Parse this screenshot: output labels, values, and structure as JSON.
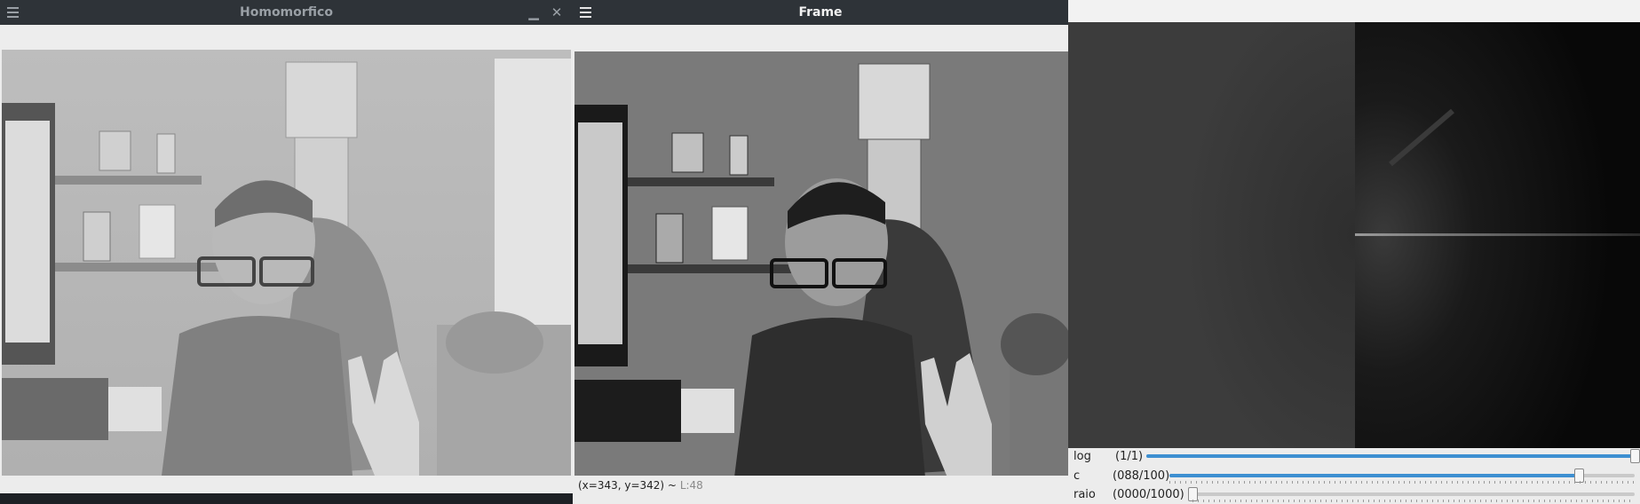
{
  "windows": {
    "homomorfico": {
      "title": "Homomorfico"
    },
    "frame": {
      "title": "Frame",
      "status": {
        "coords": "(x=343, y=342) ~",
        "level": "L:48"
      }
    },
    "spectrum": {
      "trackbars": [
        {
          "name": "log",
          "value": "(1/1)",
          "fraction": 1.0
        },
        {
          "name": "c",
          "value": "(088/100)",
          "fraction": 0.88
        },
        {
          "name": "raio",
          "value": "(0000/1000)",
          "fraction": 0.0
        }
      ]
    }
  }
}
